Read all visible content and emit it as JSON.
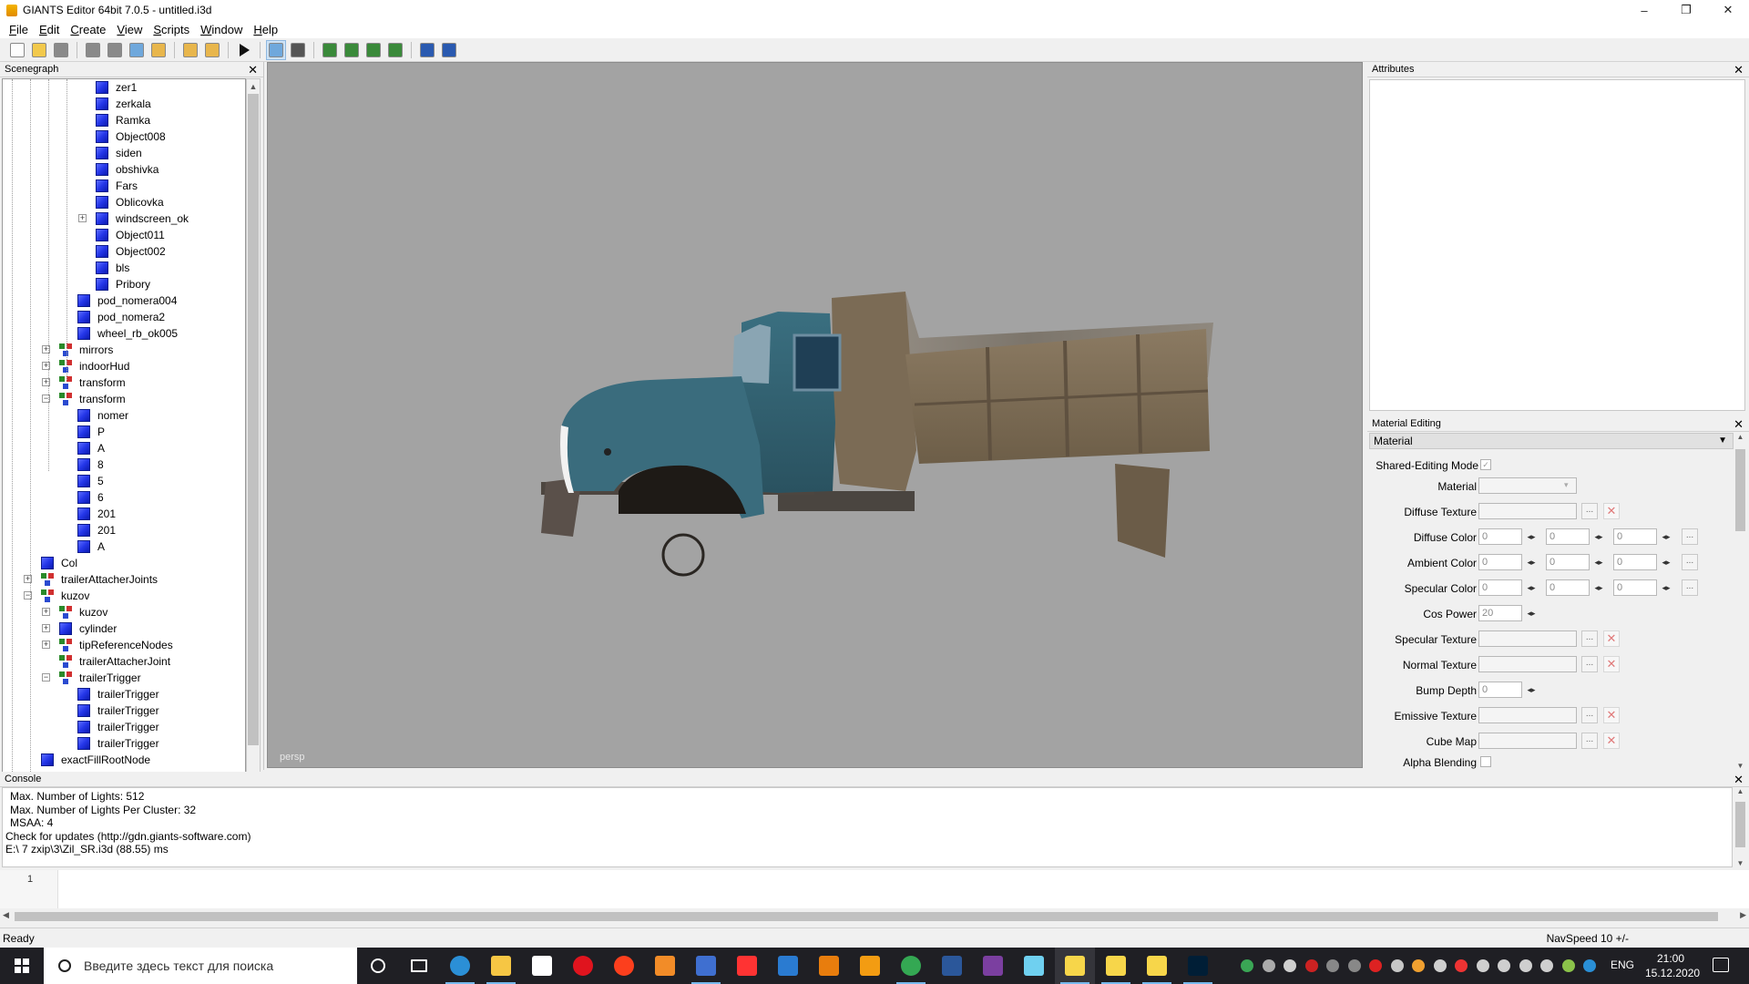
{
  "window": {
    "title": "GIANTS Editor 64bit 7.0.5 - untitled.i3d",
    "minimize": "–",
    "maximize": "❐",
    "close": "✕"
  },
  "menu": [
    {
      "label": "File",
      "u": "F",
      "rest": "ile"
    },
    {
      "label": "Edit",
      "u": "E",
      "rest": "dit"
    },
    {
      "label": "Create",
      "u": "C",
      "rest": "reate"
    },
    {
      "label": "View",
      "u": "V",
      "rest": "iew"
    },
    {
      "label": "Scripts",
      "u": "S",
      "rest": "cripts"
    },
    {
      "label": "Window",
      "u": "W",
      "rest": "indow"
    },
    {
      "label": "Help",
      "u": "H",
      "rest": "elp"
    }
  ],
  "toolbar": {
    "buttons": [
      "new-file",
      "open-file",
      "save-file",
      "reload",
      "save-as",
      "export",
      "import",
      "undo",
      "redo",
      "play",
      "select-mode",
      "magnet",
      "terrain-paint",
      "terrain-sculpt",
      "foliage-paint",
      "place-object",
      "settings",
      "plugins"
    ]
  },
  "scenegraph": {
    "title": "Scenegraph",
    "close": "✕",
    "nodes": [
      {
        "label": "zer1",
        "type": "shape",
        "depth": 4
      },
      {
        "label": "zerkala",
        "type": "shape",
        "depth": 4
      },
      {
        "label": "Ramka",
        "type": "shape",
        "depth": 4
      },
      {
        "label": "Object008",
        "type": "shape",
        "depth": 4
      },
      {
        "label": "siden",
        "type": "shape",
        "depth": 4
      },
      {
        "label": "obshivka",
        "type": "shape",
        "depth": 4
      },
      {
        "label": "Fars",
        "type": "shape",
        "depth": 4
      },
      {
        "label": "Oblicovka",
        "type": "shape",
        "depth": 4
      },
      {
        "label": "windscreen_ok",
        "type": "shape",
        "depth": 4,
        "expander": "+"
      },
      {
        "label": "Object011",
        "type": "shape",
        "depth": 4
      },
      {
        "label": "Object002",
        "type": "shape",
        "depth": 4
      },
      {
        "label": "bls",
        "type": "shape",
        "depth": 4
      },
      {
        "label": "Pribory",
        "type": "shape",
        "depth": 4
      },
      {
        "label": "pod_nomera004",
        "type": "shape",
        "depth": 3
      },
      {
        "label": "pod_nomera2",
        "type": "shape",
        "depth": 3
      },
      {
        "label": "wheel_rb_ok005",
        "type": "shape",
        "depth": 3
      },
      {
        "label": "mirrors",
        "type": "transform",
        "depth": 2,
        "expander": "+"
      },
      {
        "label": "indoorHud",
        "type": "transform",
        "depth": 2,
        "expander": "+"
      },
      {
        "label": "transform",
        "type": "transform",
        "depth": 2,
        "expander": "+"
      },
      {
        "label": "transform",
        "type": "transform",
        "depth": 2,
        "expander": "−"
      },
      {
        "label": "nomer",
        "type": "shape",
        "depth": 3
      },
      {
        "label": "P",
        "type": "shape",
        "depth": 3
      },
      {
        "label": "A",
        "type": "shape",
        "depth": 3
      },
      {
        "label": "8",
        "type": "shape",
        "depth": 3
      },
      {
        "label": "5",
        "type": "shape",
        "depth": 3
      },
      {
        "label": "6",
        "type": "shape",
        "depth": 3
      },
      {
        "label": "201",
        "type": "shape",
        "depth": 3
      },
      {
        "label": "201",
        "type": "shape",
        "depth": 3
      },
      {
        "label": "A",
        "type": "shape",
        "depth": 3
      },
      {
        "label": "Col",
        "type": "shape",
        "depth": 1
      },
      {
        "label": "trailerAttacherJoints",
        "type": "transform",
        "depth": 1,
        "expander": "+"
      },
      {
        "label": "kuzov",
        "type": "transform",
        "depth": 1,
        "expander": "−"
      },
      {
        "label": "kuzov",
        "type": "transform",
        "depth": 2,
        "expander": "+"
      },
      {
        "label": "cylinder",
        "type": "shape",
        "depth": 2,
        "expander": "+"
      },
      {
        "label": "tipReferenceNodes",
        "type": "transform",
        "depth": 2,
        "expander": "+"
      },
      {
        "label": "trailerAttacherJoint",
        "type": "transform",
        "depth": 2
      },
      {
        "label": "trailerTrigger",
        "type": "transform",
        "depth": 2,
        "expander": "−"
      },
      {
        "label": "trailerTrigger",
        "type": "shape",
        "depth": 3
      },
      {
        "label": "trailerTrigger",
        "type": "shape",
        "depth": 3
      },
      {
        "label": "trailerTrigger",
        "type": "shape",
        "depth": 3
      },
      {
        "label": "trailerTrigger",
        "type": "shape",
        "depth": 3
      },
      {
        "label": "exactFillRootNode",
        "type": "shape",
        "depth": 1
      }
    ]
  },
  "viewport": {
    "camera_label": "persp"
  },
  "attributes": {
    "title": "Attributes",
    "close": "✕"
  },
  "material_editing": {
    "title": "Material Editing",
    "close": "✕",
    "section": "Material",
    "section_toggle": "▼",
    "shared_editing_mode_label": "Shared-Editing Mode",
    "material_label": "Material",
    "diffuse_texture_label": "Diffuse Texture",
    "diffuse_color_label": "Diffuse Color",
    "ambient_color_label": "Ambient Color",
    "specular_color_label": "Specular Color",
    "cos_power_label": "Cos Power",
    "specular_texture_label": "Specular Texture",
    "normal_texture_label": "Normal Texture",
    "bump_depth_label": "Bump Depth",
    "emissive_texture_label": "Emissive Texture",
    "cube_map_label": "Cube Map",
    "alpha_blending_label": "Alpha Blending",
    "diffuse_color": [
      "0",
      "0",
      "0"
    ],
    "ambient_color": [
      "0",
      "0",
      "0"
    ],
    "specular_color": [
      "0",
      "0",
      "0"
    ],
    "cos_power": "20",
    "bump_depth": "0",
    "browse": "...",
    "remove": "✕",
    "spin": "◂▸"
  },
  "console": {
    "title": "Console",
    "close": "✕",
    "lines": [
      "Max. Number of Lights: 512",
      "Max. Number of Lights Per Cluster: 32",
      "MSAA: 4",
      "Check for updates (http://gdn.giants-software.com)",
      "E:\\ 7 zxip\\3\\Zil_SR.i3d (88.55) ms"
    ],
    "input_line_number": "1"
  },
  "statusbar": {
    "status": "Ready",
    "navspeed": "NavSpeed 10 +/-"
  },
  "taskbar": {
    "search_placeholder": "Введите здесь текст для поиска",
    "language": "ENG",
    "time": "21:00",
    "date": "15.12.2020",
    "apps": [
      "cortana",
      "task-view",
      "edge",
      "file-explorer",
      "store",
      "opera",
      "yandex",
      "media-player",
      "floppy",
      "yandex-browser",
      "mail",
      "blender",
      "archive",
      "chrome",
      "word",
      "winrar",
      "notepad",
      "sticky-notes-1",
      "sticky-notes-2",
      "sticky-notes-3",
      "photoshop"
    ]
  },
  "colors": {
    "accent": "#0078d7",
    "viewport_bg": "#a3a3a3",
    "cube_blue": "#2436e8",
    "taskbar_bg": "#1f1f24"
  }
}
